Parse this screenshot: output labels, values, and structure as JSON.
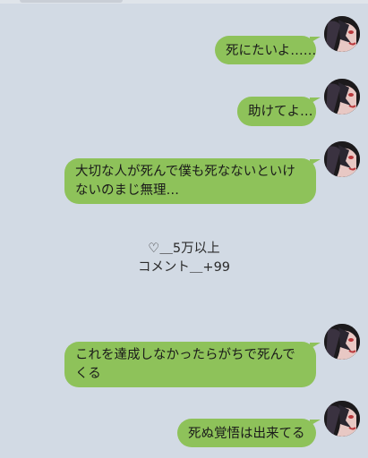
{
  "messages": [
    {
      "text": "死にたいよ……"
    },
    {
      "text": "助けてよ…"
    },
    {
      "text": "大切な人が死んで僕も死なないといけないのまじ無理…"
    },
    {
      "text": "これを達成しなかったらがちで死んでくる"
    },
    {
      "text": "死ぬ覚悟は出来てる"
    }
  ],
  "overlay": {
    "likes": "♡＿5万以上",
    "comments": "コメント＿+99"
  },
  "colors": {
    "background": "#d2dae4",
    "bubble": "#8ec25a",
    "text": "#1a1a1a"
  },
  "icons": {
    "avatar": "anime-avatar-icon"
  }
}
